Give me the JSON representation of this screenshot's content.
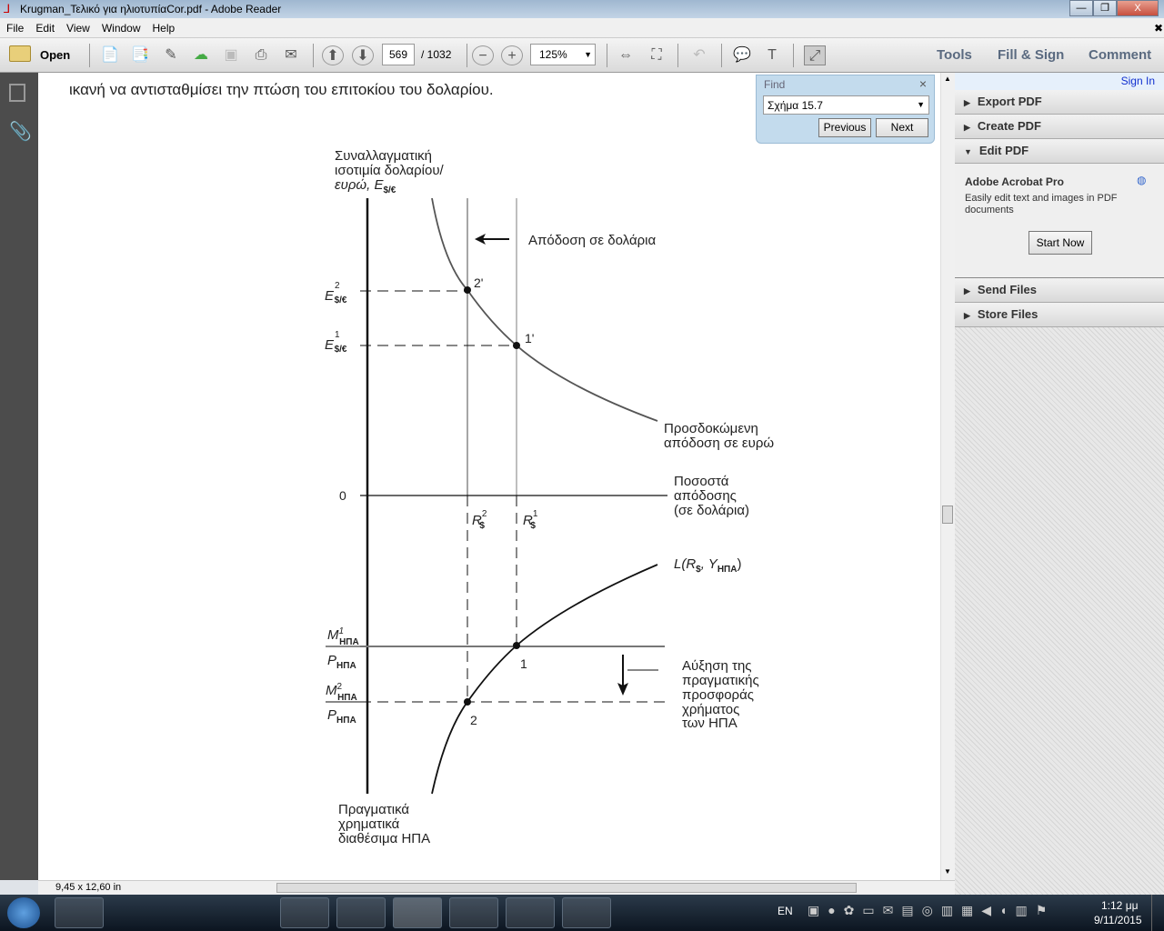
{
  "window": {
    "title": "Krugman_Τελικό για ηλιοτυπίαCor.pdf - Adobe Reader",
    "min": "—",
    "restore": "❐",
    "close": "X"
  },
  "menu": [
    "File",
    "Edit",
    "View",
    "Window",
    "Help"
  ],
  "menu_close": "✖",
  "toolbar": {
    "open": "Open",
    "page_current": "569",
    "page_total": "/ 1032",
    "zoom": "125%",
    "tools": "Tools",
    "fill_sign": "Fill & Sign",
    "comment": "Comment"
  },
  "find": {
    "title": "Find",
    "close": "×",
    "query": "Σχήμα 15.7",
    "previous": "Previous",
    "next": "Next"
  },
  "right_pane": {
    "sign_in": "Sign In",
    "sections": [
      "Export PDF",
      "Create PDF",
      "Edit PDF"
    ],
    "promo_title": "Adobe Acrobat Pro",
    "promo_text": "Easily edit text and images in PDF documents",
    "start_now": "Start Now",
    "sections2": [
      "Send Files",
      "Store Files"
    ]
  },
  "document": {
    "top_text": "ικανή να αντισταθμίσει την πτώση του επιτοκίου του δολαρίου.",
    "diagram": {
      "y_axis_label": [
        "Συναλλαγματική",
        "ισοτιμία δολαρίου/",
        "ευρώ, E"
      ],
      "y_axis_sub": "$/€",
      "e2": "E",
      "e2_sup": "2",
      "e2_sub": "$/€",
      "e1": "E",
      "e1_sup": "1",
      "e1_sub": "$/€",
      "dollar_return": "Απόδοση σε δολάρια",
      "p2p": "2'",
      "p1p": "1'",
      "euro_return": [
        "Προσδοκώμενη",
        "απόδοση σε ευρώ"
      ],
      "zero": "0",
      "x_axis_label": [
        "Ποσοστά",
        "απόδοσης",
        "(σε δολάρια)"
      ],
      "r2": "R",
      "r2_sup": "2",
      "r2_sub": "$",
      "r1": "R",
      "r1_sup": "1",
      "r1_sub": "$",
      "L_label": "L(R",
      "L_sub1": "$",
      "L_mid": ", Y",
      "L_sub2": "ΗΠΑ",
      "L_end": ")",
      "m1": "M",
      "m1_sup": "1",
      "m1_sub": "ΗΠΑ",
      "p_label": "P",
      "p_sub": "ΗΠΑ",
      "m2": "M",
      "m2_sup": "2",
      "m2_sub": "ΗΠΑ",
      "p1": "1",
      "p2": "2",
      "supply_increase": [
        "Αύξηση της",
        "πραγματικής",
        "προσφοράς",
        "χρήματος",
        "των ΗΠΑ"
      ],
      "bottom_label": [
        "Πραγματικά",
        "χρηματικά",
        "διαθέσιμα ΗΠΑ"
      ]
    }
  },
  "status": {
    "page_size": "9,45 x 12,60 in"
  },
  "taskbar": {
    "lang": "EN",
    "time": "1:12 μμ",
    "date": "9/11/2015"
  }
}
